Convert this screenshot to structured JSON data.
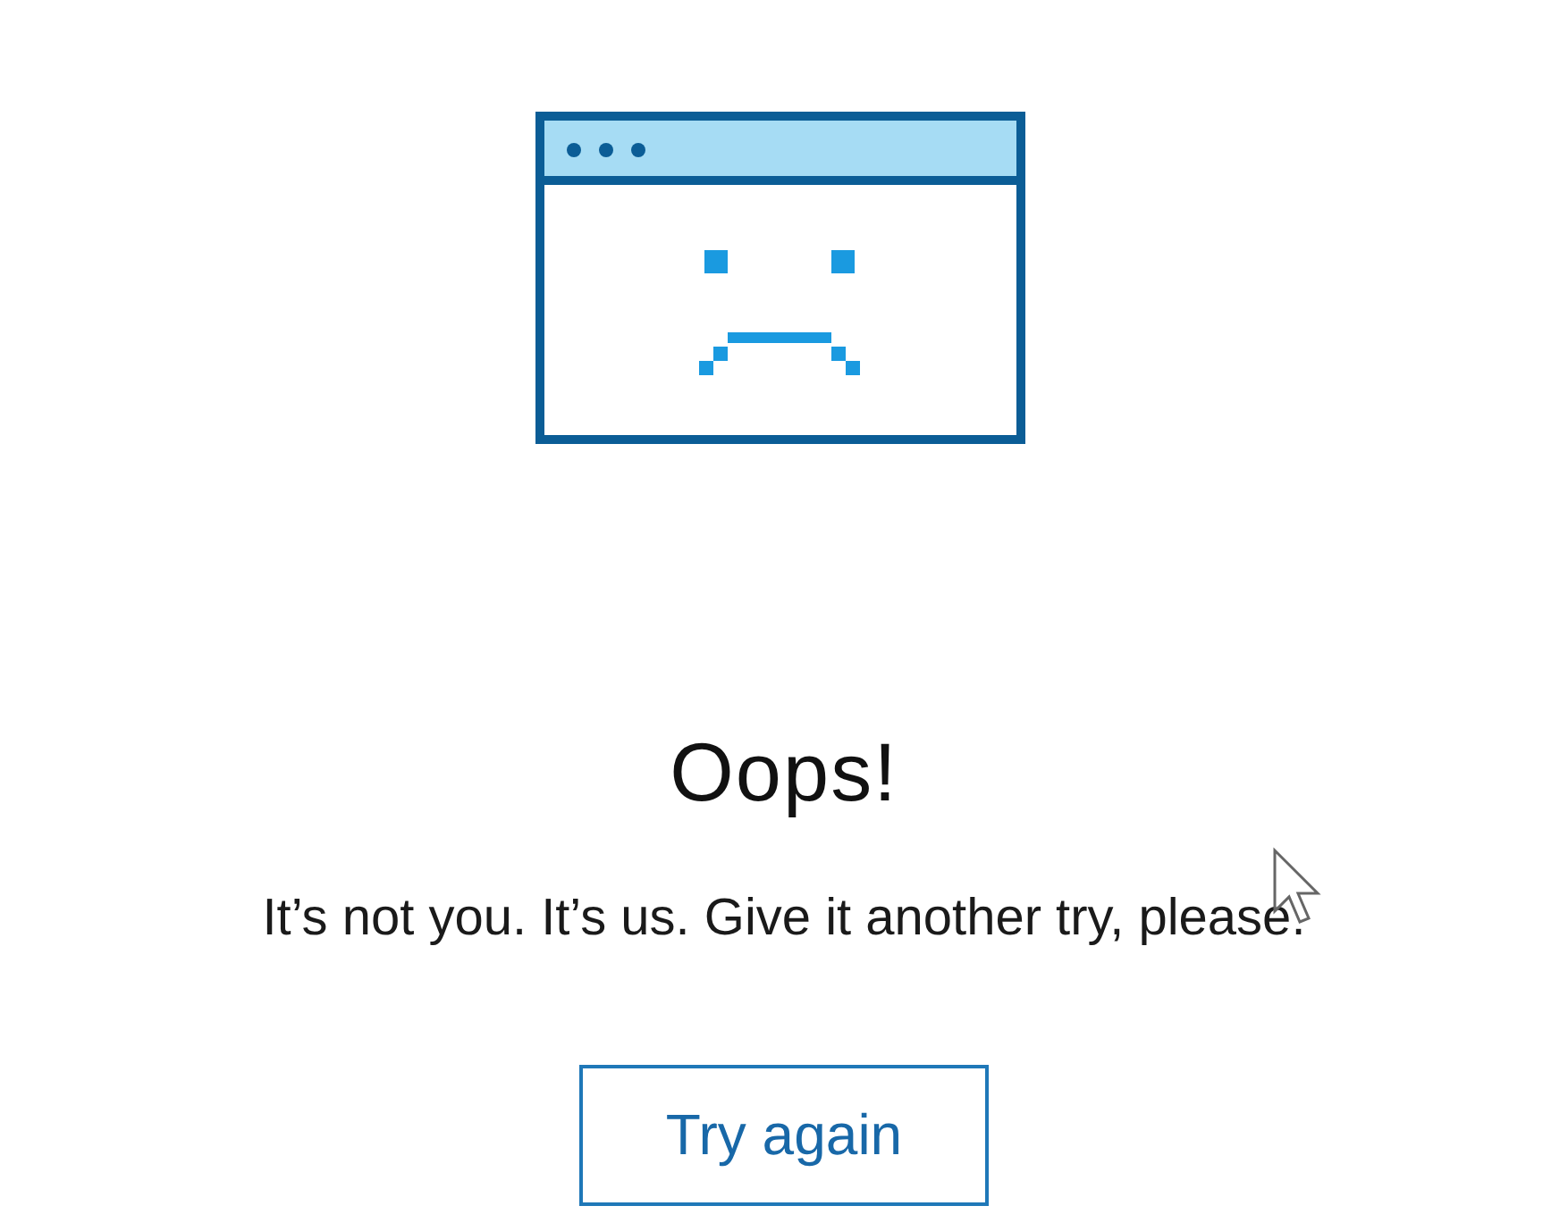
{
  "error": {
    "heading": "Oops!",
    "message": "It’s not you. It’s us. Give it another try, please.",
    "button": "Try again"
  }
}
